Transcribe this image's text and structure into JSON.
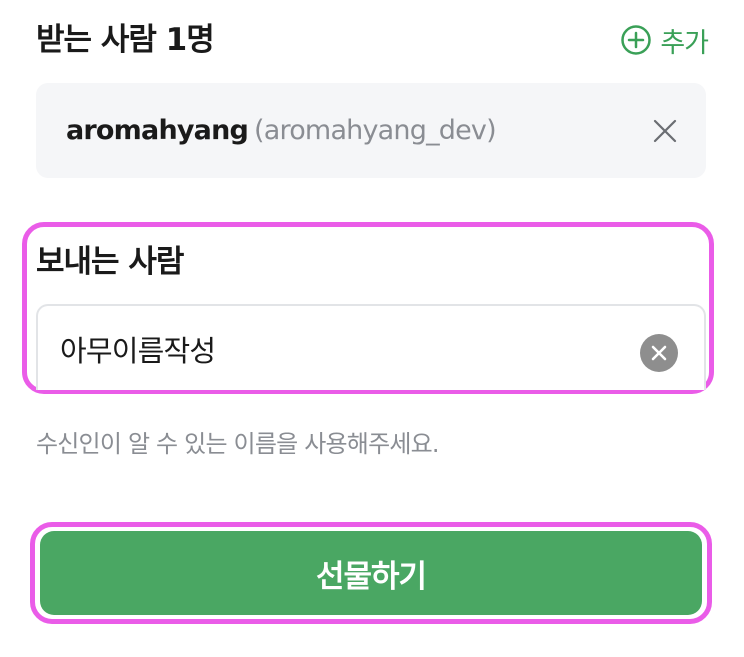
{
  "recipients": {
    "title": "받는 사람 1명",
    "add_label": "추가",
    "items": [
      {
        "name": "aromahyang",
        "id": "(aromahyang_dev)"
      }
    ]
  },
  "sender": {
    "title": "보내는 사람",
    "value": "아무이름작성",
    "helper": "수신인이 알 수 있는 이름을 사용해주세요."
  },
  "submit": {
    "label": "선물하기"
  },
  "colors": {
    "accent": "#3aa057",
    "button": "#4aa763",
    "highlight": "#ea5ce8",
    "card_bg": "#f5f6f8",
    "muted_text": "#8a8d93"
  },
  "icons": {
    "add": "plus-circle-icon",
    "remove": "close-icon",
    "clear": "clear-circle-icon"
  }
}
